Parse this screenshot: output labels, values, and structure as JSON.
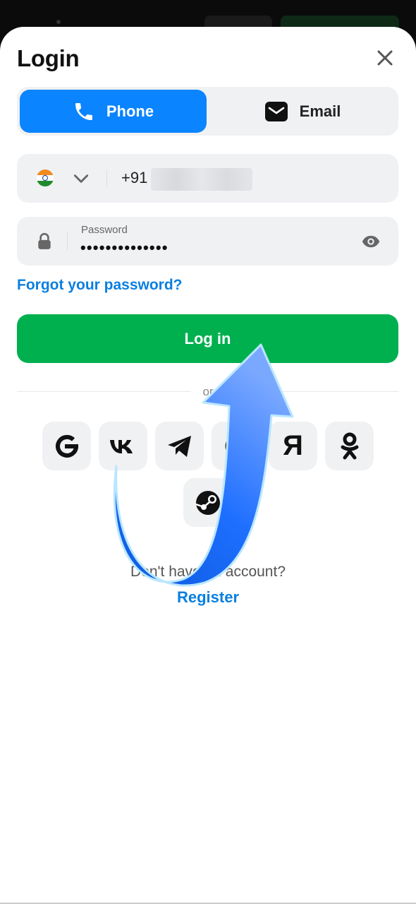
{
  "header": {
    "title": "Login"
  },
  "tabs": [
    {
      "label": "Phone",
      "active": true,
      "icon": "phone-icon"
    },
    {
      "label": "Email",
      "active": false,
      "icon": "email-icon"
    }
  ],
  "phone_field": {
    "country_flag": "india-flag-icon",
    "country_code": "+91",
    "number_redacted": true
  },
  "password_field": {
    "label": "Password",
    "value_masked": "••••••••••••••"
  },
  "links": {
    "forgot": "Forgot your password?",
    "register": "Register"
  },
  "login_button": {
    "label": "Log in"
  },
  "divider": {
    "text": "or"
  },
  "social": [
    {
      "name": "google-icon"
    },
    {
      "name": "vk-icon"
    },
    {
      "name": "telegram-icon"
    },
    {
      "name": "mailru-icon"
    },
    {
      "name": "yandex-icon",
      "glyph": "Я"
    },
    {
      "name": "odnoklassniki-icon"
    },
    {
      "name": "steam-icon"
    }
  ],
  "footer": {
    "no_account": "Don't have an account?"
  },
  "colors": {
    "accent_blue": "#0a84ff",
    "login_green": "#00b04f",
    "link_blue": "#0a7fe0",
    "field_bg": "#f0f1f3"
  }
}
